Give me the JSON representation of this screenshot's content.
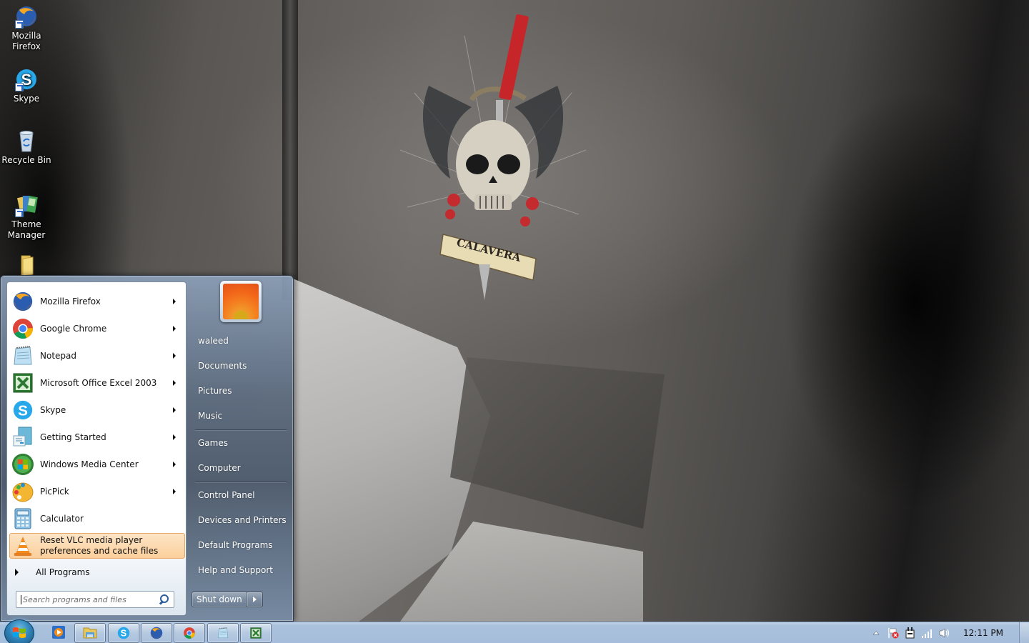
{
  "desktop": {
    "icons": [
      {
        "label": "Mozilla Firefox",
        "icon": "firefox-icon",
        "shortcut": true
      },
      {
        "label": "Skype",
        "icon": "skype-icon",
        "shortcut": true
      },
      {
        "label": "Recycle Bin",
        "icon": "recycle-bin-icon",
        "shortcut": false
      },
      {
        "label": "Theme Manager",
        "icon": "theme-manager-icon",
        "shortcut": true
      },
      {
        "label": "",
        "icon": "folder-icon",
        "shortcut": false
      }
    ],
    "wallpaper_text": "CALAVERA"
  },
  "start_menu": {
    "programs": [
      {
        "label": "Mozilla Firefox",
        "icon": "firefox-icon",
        "has_submenu": true
      },
      {
        "label": "Google Chrome",
        "icon": "chrome-icon",
        "has_submenu": true
      },
      {
        "label": "Notepad",
        "icon": "notepad-icon",
        "has_submenu": true
      },
      {
        "label": "Microsoft Office Excel 2003",
        "icon": "excel-icon",
        "has_submenu": true
      },
      {
        "label": "Skype",
        "icon": "skype-icon",
        "has_submenu": true
      },
      {
        "label": "Getting Started",
        "icon": "getting-started-icon",
        "has_submenu": true
      },
      {
        "label": "Windows Media Center",
        "icon": "media-center-icon",
        "has_submenu": true
      },
      {
        "label": "PicPick",
        "icon": "picpick-icon",
        "has_submenu": true
      },
      {
        "label": "Calculator",
        "icon": "calculator-icon",
        "has_submenu": false
      },
      {
        "label": "Reset VLC media player preferences and cache files",
        "label_line1": "Reset VLC media player",
        "label_line2": "preferences and cache files",
        "icon": "vlc-icon",
        "has_submenu": false,
        "highlighted": true
      }
    ],
    "all_programs_label": "All Programs",
    "search": {
      "placeholder": "Search programs and files",
      "value": ""
    },
    "user_name": "waleed",
    "right_items": [
      {
        "label": "Documents"
      },
      {
        "label": "Pictures"
      },
      {
        "label": "Music"
      },
      {
        "label": "Games"
      },
      {
        "label": "Computer"
      },
      {
        "label": "Control Panel"
      },
      {
        "label": "Devices and Printers"
      },
      {
        "label": "Default Programs"
      },
      {
        "label": "Help and Support"
      }
    ],
    "shutdown_label": "Shut down"
  },
  "taskbar": {
    "pinned": [
      {
        "name": "media-player",
        "icon": "media-player-icon"
      },
      {
        "name": "windows-explorer",
        "icon": "explorer-icon"
      },
      {
        "name": "skype",
        "icon": "skype-icon"
      },
      {
        "name": "firefox",
        "icon": "firefox-icon"
      },
      {
        "name": "chrome",
        "icon": "chrome-icon"
      },
      {
        "name": "notepad",
        "icon": "notepad-icon"
      },
      {
        "name": "excel",
        "icon": "excel-icon"
      }
    ],
    "tray": {
      "icons": [
        "show-hidden-icons",
        "action-center-flag-icon",
        "power-icon",
        "network-signal-icon",
        "volume-icon"
      ],
      "clock": "12:11 PM"
    }
  },
  "colors": {
    "taskbar": "#a9c0dc",
    "highlight": "#fbcf9b",
    "start_menu_right": "#5c6b7e"
  }
}
